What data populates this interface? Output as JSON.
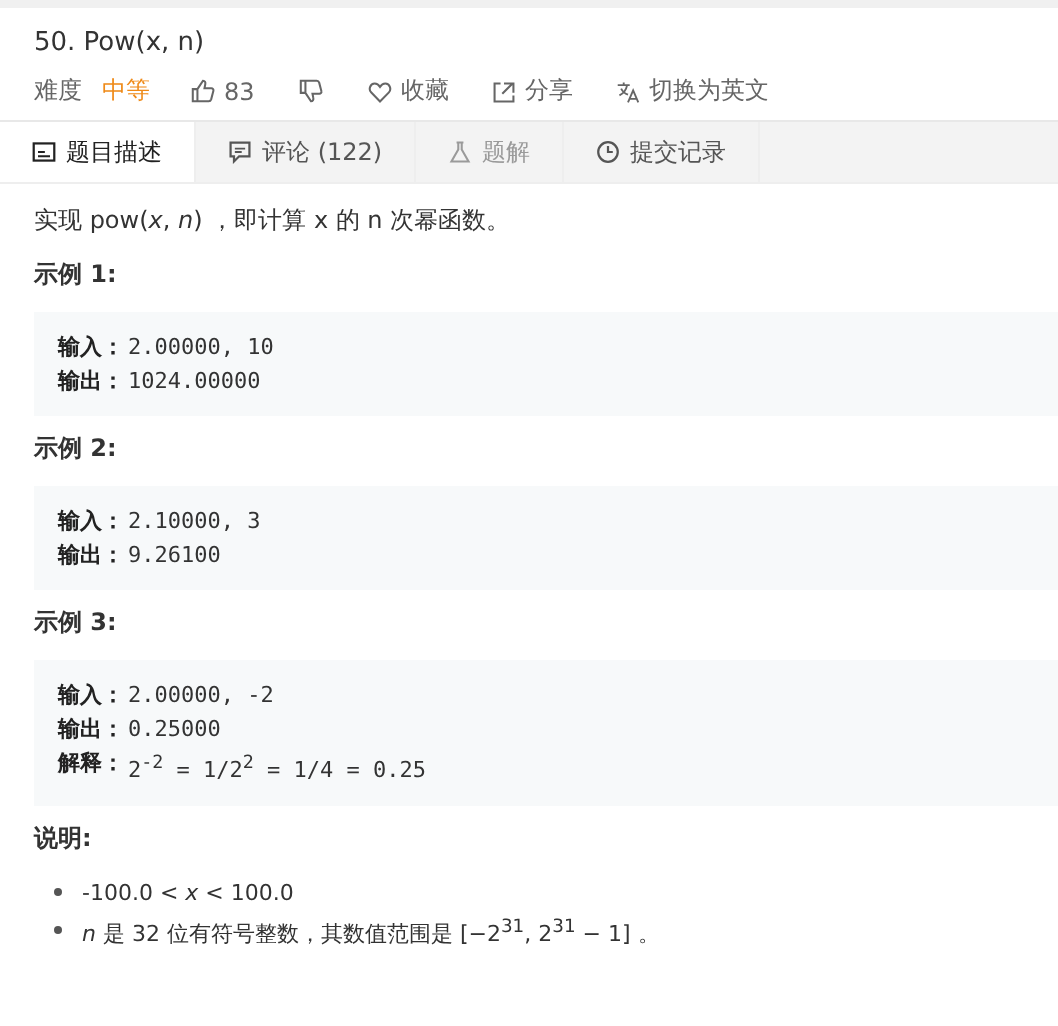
{
  "title": "50. Pow(x, n)",
  "meta": {
    "difficulty_label": "难度",
    "difficulty": "中等",
    "likes": "83",
    "favorite": "收藏",
    "share": "分享",
    "switch_language": "切换为英文"
  },
  "tabs": [
    {
      "label": "题目描述",
      "selected": true,
      "disabled": false,
      "kind": "description"
    },
    {
      "label": "评论 (122)",
      "selected": false,
      "disabled": false,
      "kind": "comment"
    },
    {
      "label": "题解",
      "selected": false,
      "disabled": true,
      "kind": "solution"
    },
    {
      "label": "提交记录",
      "selected": false,
      "disabled": false,
      "kind": "history"
    }
  ],
  "intro": "实现 pow(*x*, *n*) ，即计算 x 的 n 次幂函数。",
  "examples": [
    {
      "heading": "示例 1:",
      "lines": [
        {
          "label": "输入：",
          "value": "2.00000, 10"
        },
        {
          "label": "输出：",
          "value": "1024.00000"
        }
      ]
    },
    {
      "heading": "示例 2:",
      "lines": [
        {
          "label": "输入：",
          "value": "2.10000, 3"
        },
        {
          "label": "输出：",
          "value": "9.26100"
        }
      ]
    },
    {
      "heading": "示例 3:",
      "lines": [
        {
          "label": "输入：",
          "value": "2.00000, -2"
        },
        {
          "label": "输出：",
          "value": "0.25000"
        },
        {
          "label": "解释：",
          "value": "2$^{-2}$ = 1/2$^{2}$ = 1/4 = 0.25"
        }
      ]
    }
  ],
  "notes_heading": "说明:",
  "notes": [
    "-100.0 < *x* < 100.0",
    "*n* 是 32 位有符号整数，其数值范围是 [−2$^{31}$, 2$^{31}$ − 1] 。"
  ]
}
